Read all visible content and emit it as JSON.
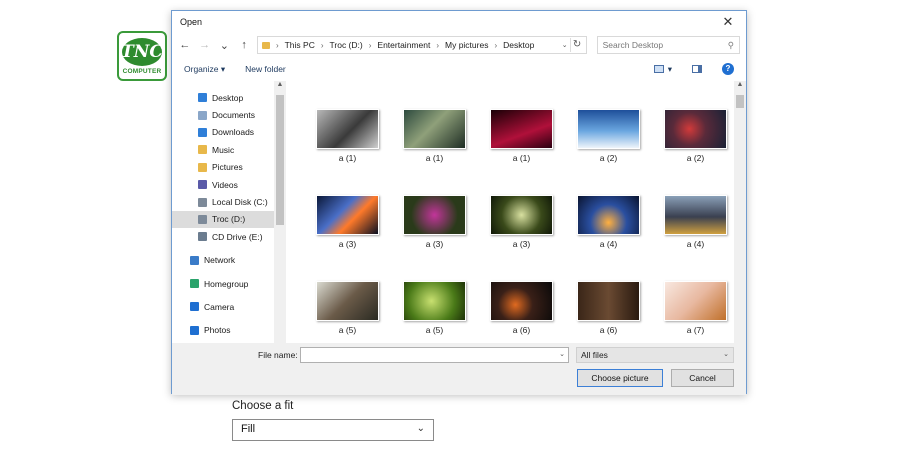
{
  "logo": {
    "mark": "TNC",
    "sub": "COMPUTER",
    "color": "#2e8b2e"
  },
  "dialog": {
    "title": "Open",
    "close_glyph": "✕",
    "nav": {
      "back": "←",
      "forward": "→",
      "recent": "⌄",
      "up": "↑"
    },
    "address": {
      "path": [
        "This PC",
        "Troc (D:)",
        "Entertainment",
        "My pictures",
        "Desktop"
      ],
      "refresh": "↻"
    },
    "search": {
      "placeholder": "Search Desktop"
    },
    "toolbar": {
      "organize": "Organize ▾",
      "new_folder": "New folder",
      "view_drop": "▾",
      "help": "?"
    },
    "sidebar": {
      "items": [
        {
          "label": "Desktop",
          "icon": "desktop-icon",
          "color": "#2f7fd8"
        },
        {
          "label": "Documents",
          "icon": "documents-icon",
          "color": "#8aa6c8"
        },
        {
          "label": "Downloads",
          "icon": "downloads-icon",
          "color": "#2f7fd8"
        },
        {
          "label": "Music",
          "icon": "music-icon",
          "color": "#e8b84a"
        },
        {
          "label": "Pictures",
          "icon": "pictures-icon",
          "color": "#e8b84a"
        },
        {
          "label": "Videos",
          "icon": "videos-icon",
          "color": "#5a5aa8"
        },
        {
          "label": "Local Disk (C:)",
          "icon": "drive-icon",
          "color": "#7d8a99"
        },
        {
          "label": "Troc (D:)",
          "icon": "drive-icon",
          "color": "#7d8a99"
        },
        {
          "label": "CD Drive (E:)",
          "icon": "cd-drive-icon",
          "color": "#6b7c8f"
        },
        {
          "label": "Network",
          "icon": "network-icon",
          "color": "#3a7bc8"
        },
        {
          "label": "Homegroup",
          "icon": "homegroup-icon",
          "color": "#2aa36b"
        },
        {
          "label": "Camera",
          "icon": "camera-icon",
          "color": "#1f6fd1"
        },
        {
          "label": "Photos",
          "icon": "photos-icon",
          "color": "#1f6fd1"
        }
      ],
      "selected": "Troc (D:)"
    },
    "files": [
      {
        "label": "a (1)",
        "bg": "linear-gradient(135deg,#b8b8b8,#3a3a3a 55%,#d0d0d0)"
      },
      {
        "label": "a (1)",
        "bg": "linear-gradient(135deg,#2d4a3e,#8fa07a 45%,#1e2d24)"
      },
      {
        "label": "a (1)",
        "bg": "linear-gradient(160deg,#1a0006,#b0103a 60%,#2a0010)"
      },
      {
        "label": "a (2)",
        "bg": "linear-gradient(180deg,#1e4f9a,#6aa6e0 55%,#eef4fa)"
      },
      {
        "label": "a (2)",
        "bg": "radial-gradient(circle at 40% 50%,#d13a3a,#5a2a3a 40%,#1a2236)"
      },
      {
        "label": "a (3)",
        "bg": "linear-gradient(135deg,#0b1838,#4a6fc8 40%,#ff7a2a 60%,#0a0f22)"
      },
      {
        "label": "a (3)",
        "bg": "radial-gradient(circle at 50% 50%,#c2359a,#2a3a1a 65%)"
      },
      {
        "label": "a (3)",
        "bg": "radial-gradient(circle at 50% 50%,#d8e0a0,#3a4a1a 55%,#101808)"
      },
      {
        "label": "a (4)",
        "bg": "radial-gradient(circle at 50% 70%,#ffb040,#2a4fa0 45%,#0a1430)"
      },
      {
        "label": "a (4)",
        "bg": "linear-gradient(180deg,#8aa0b8,#3a4050 55%,#d0a040)"
      },
      {
        "label": "a (5)",
        "bg": "linear-gradient(135deg,#dadad0,#6a5a48 50%,#2a2a22)"
      },
      {
        "label": "a (5)",
        "bg": "radial-gradient(circle at 45% 50%,#c8e070,#4a7a18 60%,#1e3208)"
      },
      {
        "label": "a (6)",
        "bg": "radial-gradient(circle at 40% 60%,#e06a20,#3a2018 40%,#080808)"
      },
      {
        "label": "a (6)",
        "bg": "linear-gradient(90deg,#3a2618,#6a4a32 50%,#2a1a10)"
      },
      {
        "label": "a (7)",
        "bg": "linear-gradient(135deg,#f8e8e0,#e8b8a0 50%,#c0702a)"
      }
    ],
    "footer": {
      "file_name_label": "File name:",
      "file_name_value": "",
      "file_type": "All files",
      "choose_button": "Choose picture",
      "cancel_button": "Cancel"
    }
  },
  "fit": {
    "label": "Choose a fit",
    "value": "Fill",
    "chevron": "⌄"
  }
}
